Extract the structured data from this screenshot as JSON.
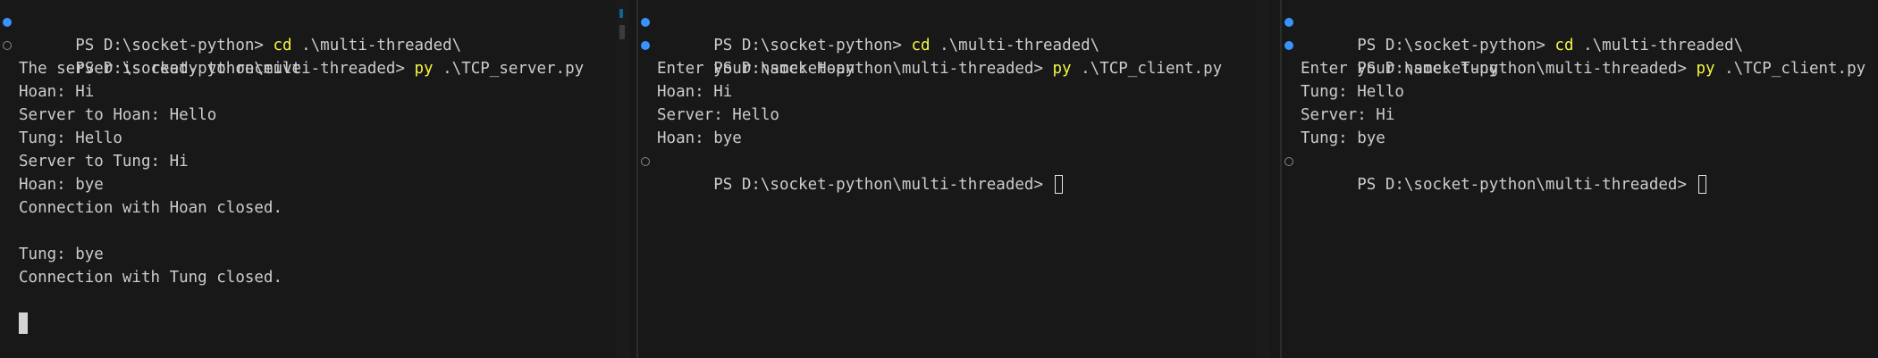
{
  "colors": {
    "background": "#181818",
    "text": "#cccccc",
    "command": "#f5f543",
    "success_marker": "#3794ff",
    "pending_marker": "#888888"
  },
  "terminals": [
    {
      "name": "server-terminal",
      "lines": [
        {
          "marker": "success",
          "prompt": "PS D:\\socket-python> ",
          "cmd": "cd",
          "arg": " .\\multi-threaded\\"
        },
        {
          "marker": "pending",
          "prompt": "PS D:\\socket-python\\multi-threaded> ",
          "cmd": "py",
          "arg": " .\\TCP_server.py"
        },
        {
          "text": "The server is ready to receive"
        },
        {
          "text": "Hoan: Hi"
        },
        {
          "text": "Server to Hoan: Hello"
        },
        {
          "text": "Tung: Hello"
        },
        {
          "text": "Server to Tung: Hi"
        },
        {
          "text": "Hoan: bye"
        },
        {
          "text": "Connection with Hoan closed."
        },
        {
          "text": ""
        },
        {
          "text": "Tung: bye"
        },
        {
          "text": "Connection with Tung closed."
        },
        {
          "text": ""
        }
      ]
    },
    {
      "name": "client-hoan-terminal",
      "lines": [
        {
          "marker": "success",
          "prompt": "PS D:\\socket-python> ",
          "cmd": "cd",
          "arg": " .\\multi-threaded\\"
        },
        {
          "marker": "success",
          "prompt": "PS D:\\socket-python\\multi-threaded> ",
          "cmd": "py",
          "arg": " .\\TCP_client.py"
        },
        {
          "text": "Enter your name: Hoan"
        },
        {
          "text": "Hoan: Hi"
        },
        {
          "text": "Server: Hello"
        },
        {
          "text": "Hoan: bye"
        },
        {
          "marker": "pending",
          "prompt": "PS D:\\socket-python\\multi-threaded> "
        }
      ]
    },
    {
      "name": "client-tung-terminal",
      "lines": [
        {
          "marker": "success",
          "prompt": "PS D:\\socket-python> ",
          "cmd": "cd",
          "arg": " .\\multi-threaded\\"
        },
        {
          "marker": "success",
          "prompt": "PS D:\\socket-python\\multi-threaded> ",
          "cmd": "py",
          "arg": " .\\TCP_client.py"
        },
        {
          "text": "Enter your name: Tung"
        },
        {
          "text": "Tung: Hello"
        },
        {
          "text": "Server: Hi"
        },
        {
          "text": "Tung: bye"
        },
        {
          "marker": "pending",
          "prompt": "PS D:\\socket-python\\multi-threaded> "
        }
      ]
    }
  ]
}
